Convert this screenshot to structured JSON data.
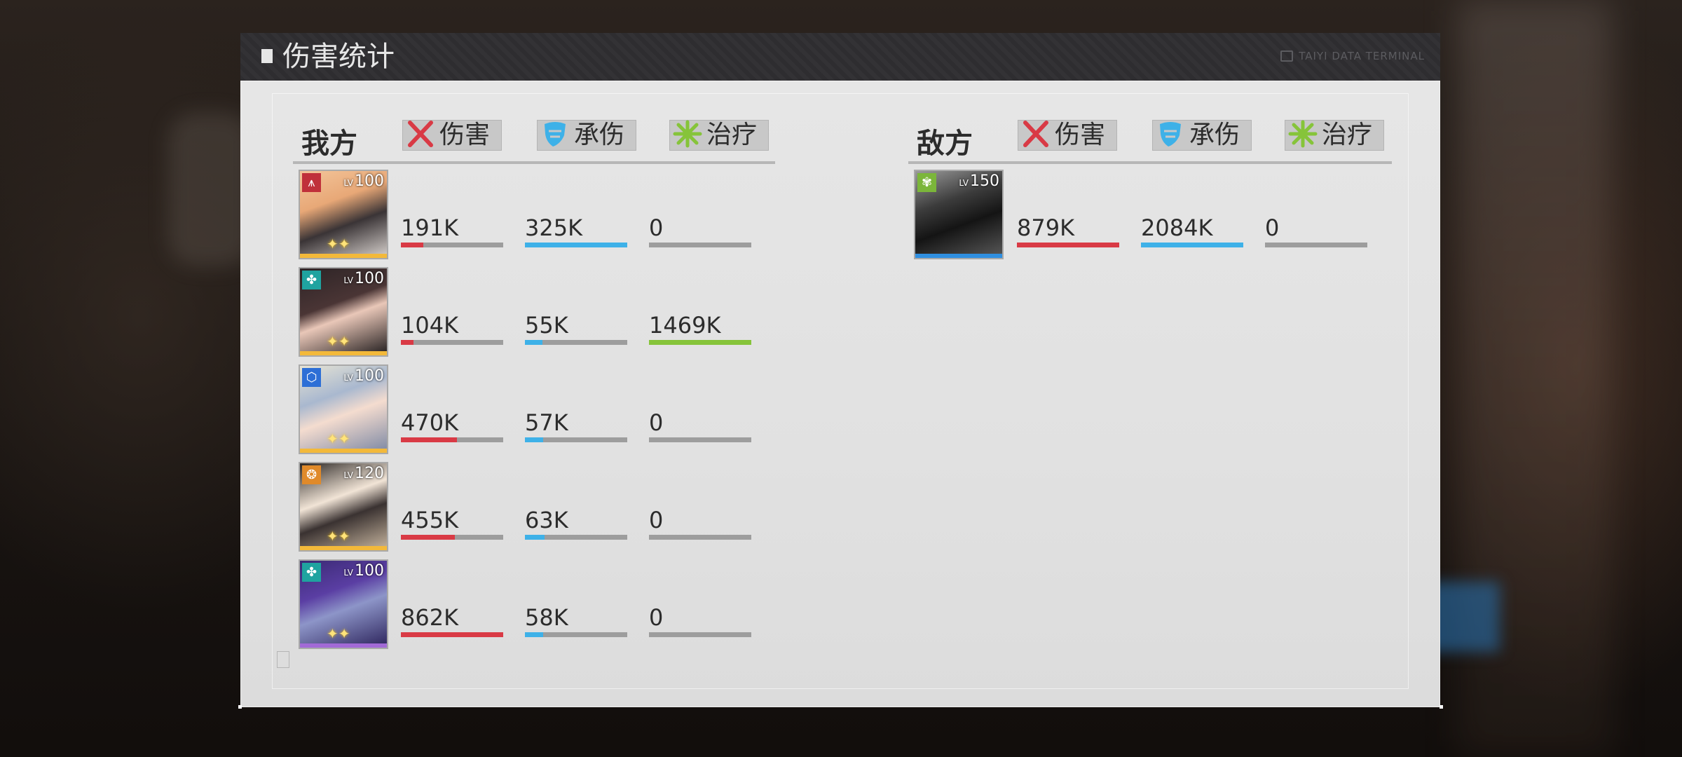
{
  "panel": {
    "title": "伤害统计",
    "terminal_label": "TAIYI DATA TERMINAL"
  },
  "colors": {
    "damage": "#d93a45",
    "taken": "#3eb1e8",
    "heal": "#86c43a",
    "rarity_gold": "#f3b93a",
    "rarity_purple": "#a26ad6",
    "rarity_blue": "#2f8fe0"
  },
  "ally": {
    "title": "我方",
    "tabs": [
      {
        "label": "伤害",
        "icon": "crossed-swords-icon"
      },
      {
        "label": "承伤",
        "icon": "shield-icon"
      },
      {
        "label": "治疗",
        "icon": "heal-burst-icon"
      }
    ],
    "rows": [
      {
        "level": "100",
        "element_icon": "tower-icon",
        "element_color": "#c0303a",
        "rarity": "gold",
        "art": "blonde-girl-portrait",
        "damage": "191K",
        "damage_frac": 0.22,
        "taken": "325K",
        "taken_frac": 1.0,
        "heal": "0",
        "heal_frac": 0
      },
      {
        "level": "100",
        "element_icon": "flower-icon",
        "element_color": "#1fa3a0",
        "rarity": "gold",
        "art": "dark-hair-girl-portrait",
        "damage": "104K",
        "damage_frac": 0.12,
        "taken": "55K",
        "taken_frac": 0.17,
        "heal": "1469K",
        "heal_frac": 1.0
      },
      {
        "level": "100",
        "element_icon": "hexagon-icon",
        "element_color": "#2d6fd6",
        "rarity": "gold",
        "art": "silver-hair-girl-portrait",
        "damage": "470K",
        "damage_frac": 0.545,
        "taken": "57K",
        "taken_frac": 0.18,
        "heal": "0",
        "heal_frac": 0
      },
      {
        "level": "120",
        "element_icon": "flame-icon",
        "element_color": "#e08a2a",
        "rarity": "gold",
        "art": "eyepatch-girl-portrait",
        "damage": "455K",
        "damage_frac": 0.53,
        "taken": "63K",
        "taken_frac": 0.19,
        "heal": "0",
        "heal_frac": 0
      },
      {
        "level": "100",
        "element_icon": "flower-icon",
        "element_color": "#1fa3a0",
        "rarity": "purple",
        "art": "purple-hair-girl-portrait",
        "damage": "862K",
        "damage_frac": 1.0,
        "taken": "58K",
        "taken_frac": 0.18,
        "heal": "0",
        "heal_frac": 0
      }
    ]
  },
  "enemy": {
    "title": "敌方",
    "tabs": [
      {
        "label": "伤害",
        "icon": "crossed-swords-icon"
      },
      {
        "label": "承伤",
        "icon": "shield-icon"
      },
      {
        "label": "治疗",
        "icon": "heal-burst-icon"
      }
    ],
    "rows": [
      {
        "level": "150",
        "element_icon": "leaf-icon",
        "element_color": "#7bb63a",
        "rarity": "blue",
        "art": "shadow-boss-portrait",
        "damage": "879K",
        "damage_frac": 1.0,
        "taken": "2084K",
        "taken_frac": 1.0,
        "heal": "0",
        "heal_frac": 0
      }
    ]
  }
}
